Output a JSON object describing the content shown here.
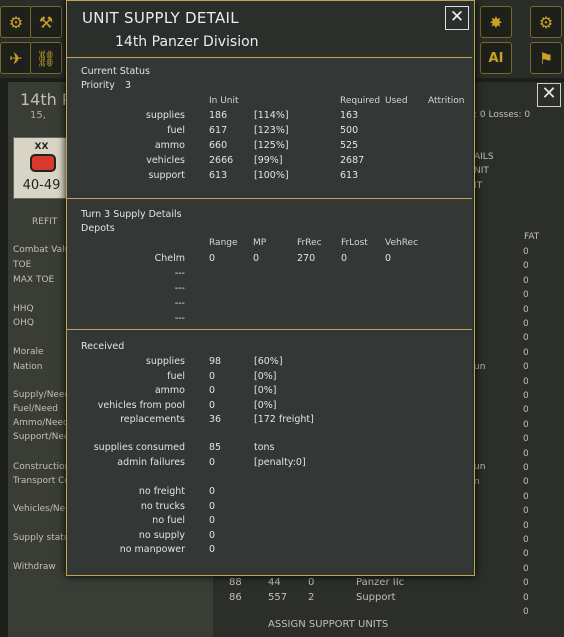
{
  "dialog": {
    "title": "UNIT SUPPLY DETAIL",
    "unit_name": "14th Panzer Division",
    "close_glyph": "✕"
  },
  "current_status": {
    "heading": "Current Status",
    "priority_label": "Priority",
    "priority_value": "3",
    "col_in_unit": "In Unit",
    "col_required": "Required",
    "col_used": "Used",
    "col_attrition": "Attrition",
    "rows": [
      {
        "label": "supplies",
        "value": "186",
        "pct": "[114%]",
        "required": "163"
      },
      {
        "label": "fuel",
        "value": "617",
        "pct": "[123%]",
        "required": "500"
      },
      {
        "label": "ammo",
        "value": "660",
        "pct": "[125%]",
        "required": "525"
      },
      {
        "label": "vehicles",
        "value": "2666",
        "pct": "[99%]",
        "required": "2687"
      },
      {
        "label": "support",
        "value": "613",
        "pct": "[100%]",
        "required": "613"
      }
    ]
  },
  "turn_details": {
    "heading": "Turn 3 Supply Details",
    "depots_label": "Depots",
    "columns": [
      "Range",
      "MP",
      "FrRec",
      "FrLost",
      "VehRec"
    ],
    "rows": [
      {
        "name": "Chelm",
        "range": "0",
        "mp": "0",
        "frrec": "270",
        "frlost": "0",
        "vehrec": "0"
      },
      {
        "name": "---"
      },
      {
        "name": "---"
      },
      {
        "name": "---"
      },
      {
        "name": "---"
      }
    ]
  },
  "received": {
    "heading": "Received",
    "rows": [
      {
        "label": "supplies",
        "value": "98",
        "extra": "[60%]"
      },
      {
        "label": "fuel",
        "value": "0",
        "extra": "[0%]"
      },
      {
        "label": "ammo",
        "value": "0",
        "extra": "[0%]"
      },
      {
        "label": "vehicles from pool",
        "value": "0",
        "extra": "[0%]"
      },
      {
        "label": "replacements",
        "value": "36",
        "extra": "[172 freight]"
      }
    ],
    "consumed_label": "supplies consumed",
    "consumed_value": "85",
    "consumed_unit": "tons",
    "admin_label": "admin failures",
    "admin_value": "0",
    "admin_extra": "[penalty:0]",
    "failures": [
      {
        "label": "no freight",
        "value": "0"
      },
      {
        "label": "no trucks",
        "value": "0"
      },
      {
        "label": "no fuel",
        "value": "0"
      },
      {
        "label": "no supply",
        "value": "0"
      },
      {
        "label": "no manpower",
        "value": "0"
      }
    ]
  },
  "background": {
    "unit_title": "14th Pa",
    "unit_sub": "15,",
    "counter_type": "XX",
    "counter_value": "40-49",
    "refit": "REFIT",
    "left_labels": [
      "Combat Valu",
      "TOE",
      "MAX TOE",
      "HHQ",
      "OHQ",
      "Morale",
      "Nation",
      "Supply/Need",
      "Fuel/Need",
      "Ammo/Need",
      "Support/Nee",
      "Construction",
      "Transport Co",
      "Vehicles/Nee",
      "Supply status",
      "Withdraw"
    ],
    "right_labels": {
      "losses": ": 0  Losses: 0",
      "ails": "AILS",
      "nit": "NIT",
      "it": "IT",
      "fat": "FAT",
      "un1": "un",
      "un2": "un",
      "n3": "n"
    },
    "fat_values": [
      "0",
      "0",
      "0",
      "0",
      "0",
      "0",
      "0",
      "0",
      "0",
      "0",
      "0",
      "0",
      "0",
      "0",
      "0",
      "0",
      "0",
      "0",
      "0",
      "0",
      "0",
      "0",
      "0",
      "0",
      "0",
      "0"
    ],
    "bottom_rows": [
      {
        "a": "88",
        "b": "44",
        "c": "0",
        "name": "Panzer IIc"
      },
      {
        "a": "86",
        "b": "557",
        "c": "2",
        "name": "Support"
      }
    ],
    "assign_button": "ASSIGN SUPPORT UNITS",
    "ai_label": "AI"
  },
  "colors": {
    "border": "#c2a54a",
    "panel": "#333735",
    "text": "#e4e4e0"
  }
}
